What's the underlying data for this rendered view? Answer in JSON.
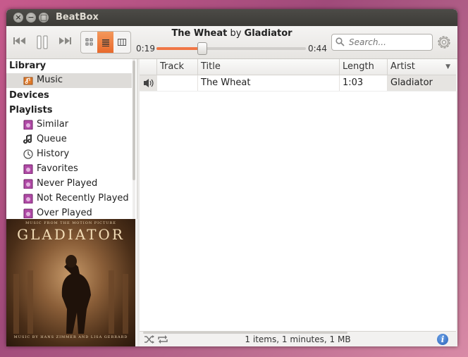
{
  "window": {
    "title": "BeatBox"
  },
  "player": {
    "track": "The Wheat",
    "by": "by",
    "artist": "Gladiator",
    "elapsed": "0:19",
    "remaining": "0:44",
    "progress_fraction": 0.3
  },
  "search": {
    "placeholder": "Search..."
  },
  "sidebar": {
    "sections": [
      {
        "label": "Library"
      },
      {
        "label": "Devices"
      },
      {
        "label": "Playlists"
      }
    ],
    "library_items": [
      {
        "label": "Music",
        "icon": "music-library-icon"
      }
    ],
    "playlist_items": [
      {
        "label": "Similar",
        "icon": "smart-playlist-icon"
      },
      {
        "label": "Queue",
        "icon": "music-note-icon"
      },
      {
        "label": "History",
        "icon": "history-clock-icon"
      },
      {
        "label": "Favorites",
        "icon": "smart-playlist-icon"
      },
      {
        "label": "Never Played",
        "icon": "smart-playlist-icon"
      },
      {
        "label": "Not Recently Played",
        "icon": "smart-playlist-icon"
      },
      {
        "label": "Over Played",
        "icon": "smart-playlist-icon"
      }
    ]
  },
  "album_art": {
    "top_text": "MUSIC FROM THE MOTION PICTURE",
    "title": "GLADIATOR",
    "bottom_text": "MUSIC BY HANS ZIMMER AND LISA GERRARD"
  },
  "table": {
    "columns": [
      "",
      "Track",
      "Title",
      "Length",
      "Artist"
    ],
    "rows": [
      {
        "track": "",
        "title": "The Wheat",
        "length": "1:03",
        "artist": "Gladiator"
      }
    ]
  },
  "status": {
    "text": "1 items, 1 minutes, 1 MB"
  },
  "colors": {
    "accent": "#f07746",
    "titlebar": "#3c3b37",
    "playlist_icon": "#b04aa6"
  }
}
